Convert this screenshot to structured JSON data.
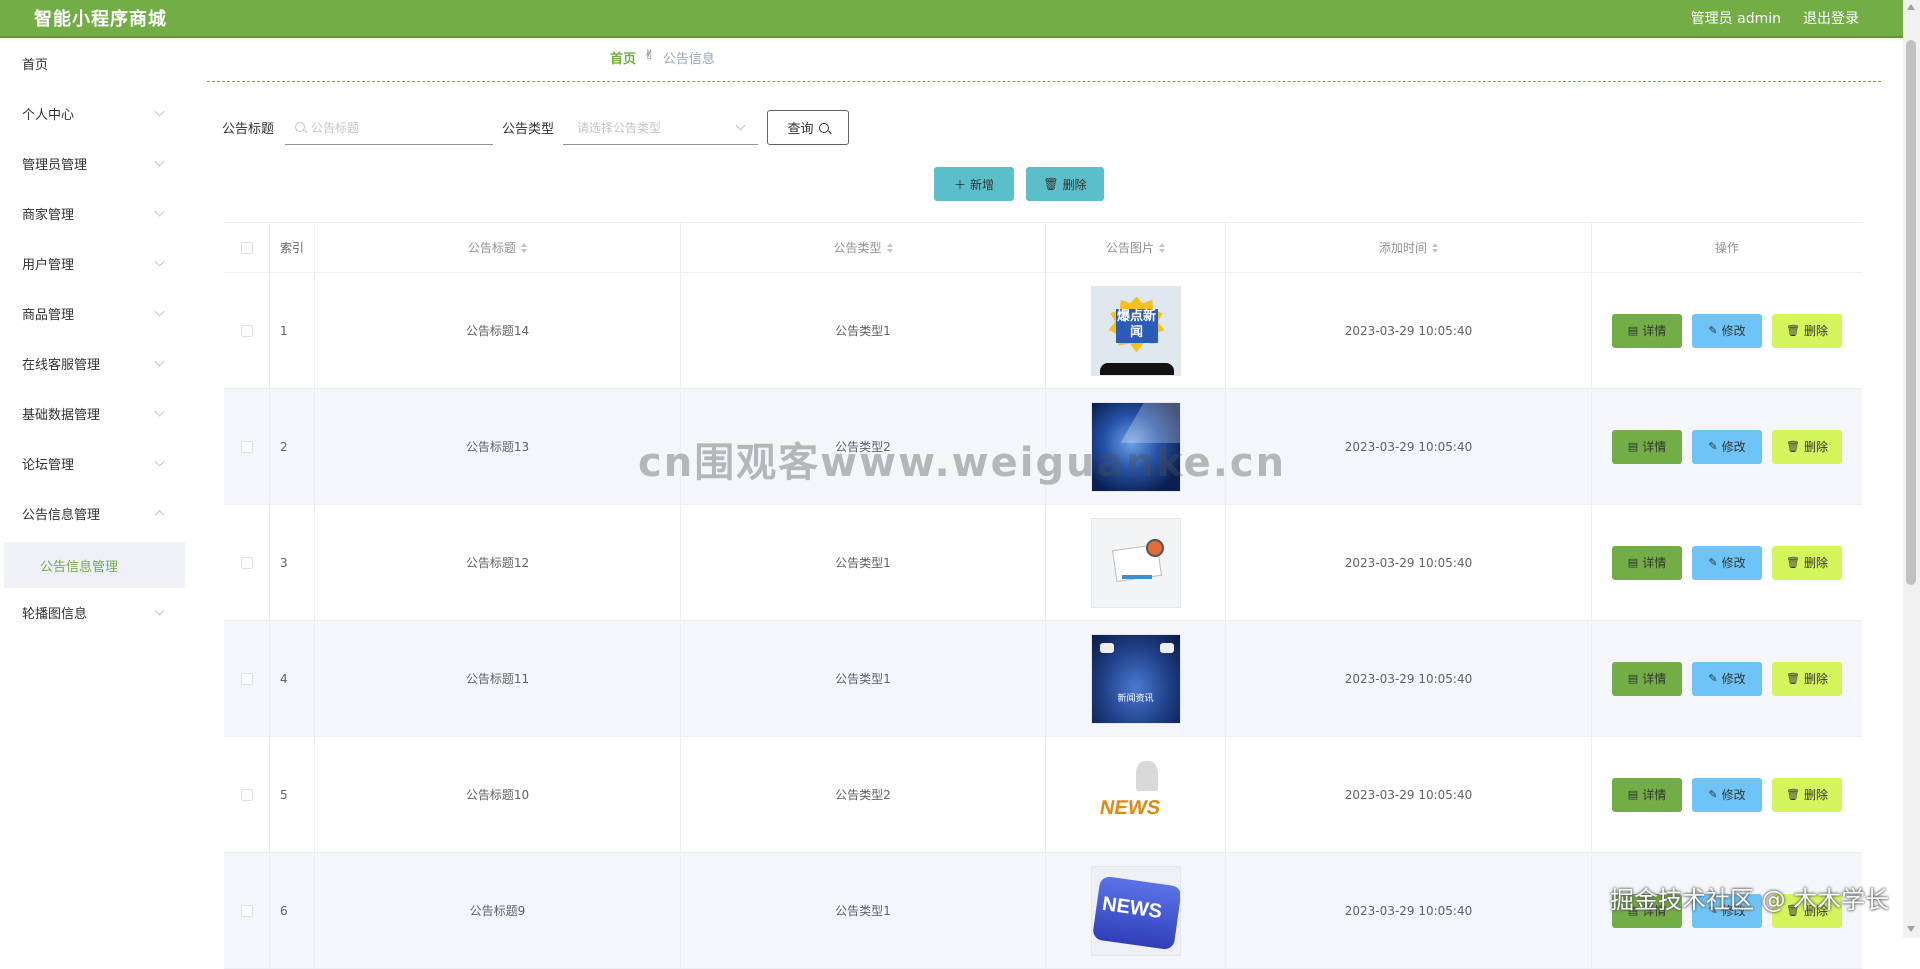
{
  "app": {
    "title": "智能小程序商城"
  },
  "header": {
    "user": "管理员 admin",
    "logout": "退出登录"
  },
  "sidebar": {
    "items": [
      {
        "label": "首页",
        "has_children": false
      },
      {
        "label": "个人中心",
        "has_children": true
      },
      {
        "label": "管理员管理",
        "has_children": true
      },
      {
        "label": "商家管理",
        "has_children": true
      },
      {
        "label": "用户管理",
        "has_children": true
      },
      {
        "label": "商品管理",
        "has_children": true
      },
      {
        "label": "在线客服管理",
        "has_children": true
      },
      {
        "label": "基础数据管理",
        "has_children": true
      },
      {
        "label": "论坛管理",
        "has_children": true
      },
      {
        "label": "公告信息管理",
        "has_children": true,
        "expanded": true
      },
      {
        "label": "轮播图信息",
        "has_children": true
      }
    ],
    "active_sub": "公告信息管理"
  },
  "breadcrumb": {
    "home": "首页",
    "current": "公告信息"
  },
  "search": {
    "title_label": "公告标题",
    "title_placeholder": "公告标题",
    "type_label": "公告类型",
    "type_placeholder": "请选择公告类型",
    "query_button": "查询"
  },
  "actions": {
    "add": "新增",
    "delete": "删除"
  },
  "table": {
    "columns": {
      "index": "索引",
      "title": "公告标题",
      "type": "公告类型",
      "image": "公告图片",
      "time": "添加时间",
      "ops": "操作"
    },
    "op_labels": {
      "detail": "详情",
      "edit": "修改",
      "delete": "删除"
    },
    "rows": [
      {
        "index": "1",
        "title": "公告标题14",
        "type": "公告类型1",
        "time": "2023-03-29 10:05:40"
      },
      {
        "index": "2",
        "title": "公告标题13",
        "type": "公告类型2",
        "time": "2023-03-29 10:05:40"
      },
      {
        "index": "3",
        "title": "公告标题12",
        "type": "公告类型1",
        "time": "2023-03-29 10:05:40"
      },
      {
        "index": "4",
        "title": "公告标题11",
        "type": "公告类型1",
        "time": "2023-03-29 10:05:40"
      },
      {
        "index": "5",
        "title": "公告标题10",
        "type": "公告类型2",
        "time": "2023-03-29 10:05:40"
      },
      {
        "index": "6",
        "title": "公告标题9",
        "type": "公告类型1",
        "time": "2023-03-29 10:05:40"
      }
    ]
  },
  "images": {
    "img1_text": "爆点新闻",
    "img4_text": "新闻资讯",
    "img5_text": "NEWS",
    "img6_text": "NEWS"
  },
  "watermarks": {
    "center": "cn围观客www.weiguanke.cn",
    "corner": "掘金技术社区 @ 木木学长"
  },
  "colors": {
    "header": "#72ad46",
    "accent": "#72ad46",
    "teal": "#5bbfc9",
    "edit": "#6ec4f7",
    "delete": "#d5f55c"
  }
}
